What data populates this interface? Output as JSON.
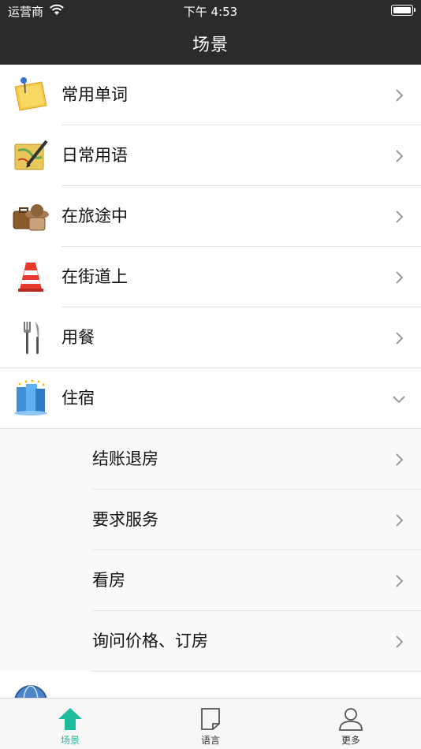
{
  "status": {
    "carrier": "运营商",
    "time": "下午 4:53"
  },
  "navbar": {
    "title": "场景"
  },
  "list": {
    "items": [
      {
        "label": "常用单词",
        "icon": "sticky-note-icon"
      },
      {
        "label": "日常用语",
        "icon": "map-pencil-icon"
      },
      {
        "label": "在旅途中",
        "icon": "luggage-hat-icon"
      },
      {
        "label": "在街道上",
        "icon": "traffic-cone-icon"
      },
      {
        "label": "用餐",
        "icon": "fork-knife-icon"
      },
      {
        "label": "住宿",
        "icon": "hotel-building-icon",
        "expanded": true
      }
    ],
    "subitems": [
      {
        "label": "结账退房"
      },
      {
        "label": "要求服务"
      },
      {
        "label": "看房"
      },
      {
        "label": "询问价格、订房"
      }
    ],
    "partial_item_icon": "globe-icon"
  },
  "tabbar": {
    "tabs": [
      {
        "label": "场景",
        "icon": "home-arrow-icon",
        "active": true
      },
      {
        "label": "语言",
        "icon": "note-icon",
        "active": false
      },
      {
        "label": "更多",
        "icon": "person-icon",
        "active": false
      }
    ],
    "accent": "#1cbc9c"
  }
}
